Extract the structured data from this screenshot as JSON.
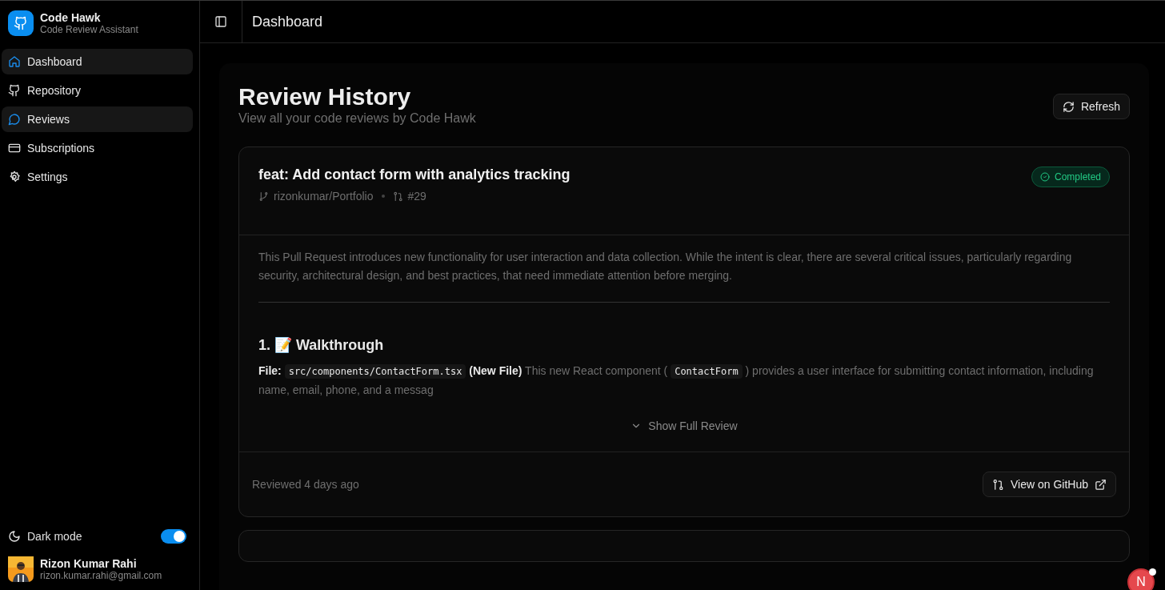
{
  "app": {
    "name": "Code Hawk",
    "subtitle": "Code Review Assistant"
  },
  "sidebar": {
    "items": [
      {
        "label": "Dashboard",
        "kind": "home",
        "selected": true
      },
      {
        "label": "Repository",
        "kind": "repo",
        "selected": false
      },
      {
        "label": "Reviews",
        "kind": "reviews",
        "selected": true
      },
      {
        "label": "Subscriptions",
        "kind": "billing",
        "selected": false
      },
      {
        "label": "Settings",
        "kind": "settings",
        "selected": false
      }
    ]
  },
  "dark_mode": {
    "label": "Dark mode",
    "on": true
  },
  "user": {
    "name": "Rizon Kumar Rahi",
    "email": "rizon.kumar.rahi@gmail.com"
  },
  "header": {
    "title": "Dashboard"
  },
  "page": {
    "title": "Review History",
    "subtitle": "View all your code reviews by Code Hawk",
    "refresh_button": "Refresh"
  },
  "reviews": [
    {
      "title": "feat: Add contact form with analytics tracking",
      "repo": "rizonkumar/Portfolio",
      "pr": "#29",
      "status": {
        "kind": "completed",
        "label": "Completed"
      },
      "summary": "This Pull Request introduces new functionality for user interaction and data collection. While the intent is clear, there are several critical issues, particularly regarding security, architectural design, and best practices, that need immediate attention before merging.",
      "section_heading": "1. 📝 Walkthrough",
      "body": [
        {
          "kind": "bold",
          "text": "File:"
        },
        {
          "kind": "code",
          "text": "src/components/ContactForm.tsx"
        },
        {
          "kind": "bold",
          "text": "(New File)"
        },
        {
          "kind": "text",
          "text": "This new React component ("
        },
        {
          "kind": "code",
          "text": "ContactForm"
        },
        {
          "kind": "text",
          "text": ") provides a user interface for submitting contact information, including name, email, phone, and a messag"
        }
      ],
      "expand_label": "Show Full Review",
      "reviewed": "Reviewed 4 days ago",
      "github_button": "View on GitHub"
    }
  ],
  "dev_badge": "N"
}
